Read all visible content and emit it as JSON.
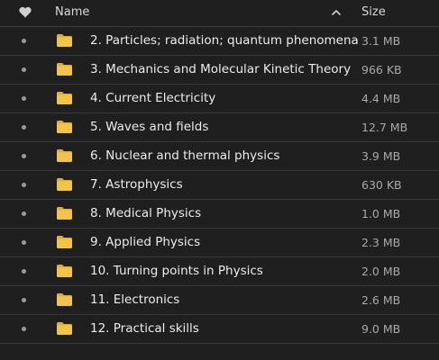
{
  "header": {
    "favorite_icon": "heart-icon",
    "name_label": "Name",
    "sort_icon": "chevron-up-icon",
    "size_label": "Size"
  },
  "colors": {
    "background": "#1f1f1f",
    "folder": "#f2c24b",
    "folder_tab": "#e3ad33",
    "text": "#ececec",
    "muted_text": "#a8a8a8"
  },
  "files": [
    {
      "name": "2. Particles; radiation; quantum phenomena",
      "size": "3.1 MB",
      "icon": "folder-icon"
    },
    {
      "name": "3. Mechanics and Molecular Kinetic Theory",
      "size": "966 KB",
      "icon": "folder-icon"
    },
    {
      "name": "4. Current Electricity",
      "size": "4.4 MB",
      "icon": "folder-icon"
    },
    {
      "name": "5. Waves and fields",
      "size": "12.7 MB",
      "icon": "folder-icon"
    },
    {
      "name": "6. Nuclear and thermal physics",
      "size": "3.9 MB",
      "icon": "folder-icon"
    },
    {
      "name": "7. Astrophysics",
      "size": "630 KB",
      "icon": "folder-icon"
    },
    {
      "name": "8. Medical Physics",
      "size": "1.0 MB",
      "icon": "folder-icon"
    },
    {
      "name": "9. Applied Physics",
      "size": "2.3 MB",
      "icon": "folder-icon"
    },
    {
      "name": "10. Turning points in Physics",
      "size": "2.0 MB",
      "icon": "folder-icon"
    },
    {
      "name": "11. Electronics",
      "size": "2.6 MB",
      "icon": "folder-icon"
    },
    {
      "name": "12. Practical skills",
      "size": "9.0 MB",
      "icon": "folder-icon"
    }
  ]
}
